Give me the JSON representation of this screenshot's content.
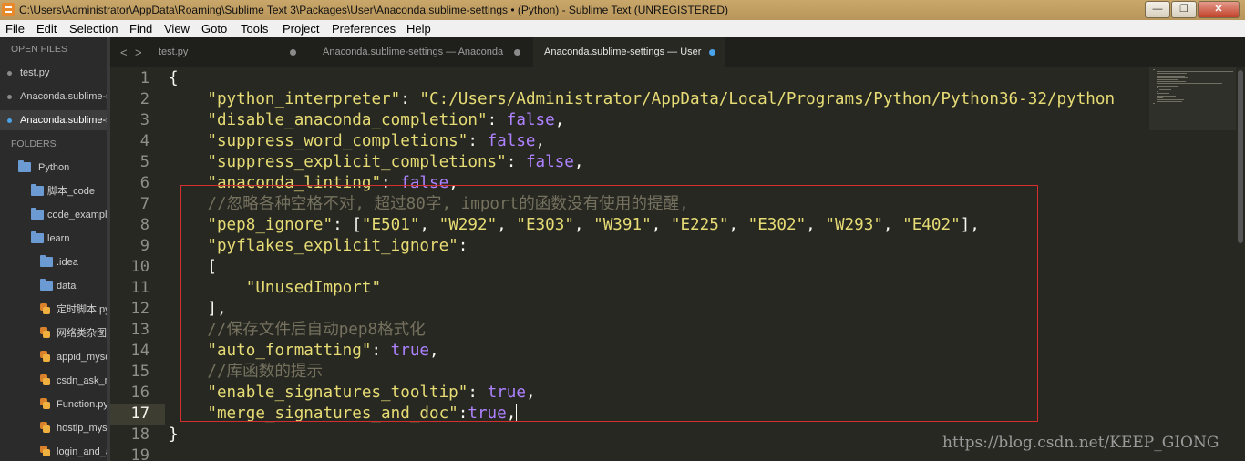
{
  "window": {
    "title": "C:\\Users\\Administrator\\AppData\\Roaming\\Sublime Text 3\\Packages\\User\\Anaconda.sublime-settings • (Python) - Sublime Text (UNREGISTERED)",
    "minimize": "—",
    "maximize": "❐",
    "close": "✕"
  },
  "menu": [
    "File",
    "Edit",
    "Selection",
    "Find",
    "View",
    "Goto",
    "Tools",
    "Project",
    "Preferences",
    "Help"
  ],
  "sidebar": {
    "open_files_header": "OPEN FILES",
    "open_files": [
      {
        "label": "test.py",
        "active": false
      },
      {
        "label": "Anaconda.sublime-s",
        "active": false
      },
      {
        "label": "Anaconda.sublime-s",
        "active": true
      }
    ],
    "folders_header": "FOLDERS",
    "tree": [
      {
        "label": "Python",
        "kind": "folder",
        "depth": 0,
        "open": true
      },
      {
        "label": "脚本_code",
        "kind": "folder",
        "depth": 1
      },
      {
        "label": "code_example",
        "kind": "folder",
        "depth": 1
      },
      {
        "label": "learn",
        "kind": "folder",
        "depth": 1,
        "open": true
      },
      {
        "label": ".idea",
        "kind": "folder",
        "depth": 2
      },
      {
        "label": "data",
        "kind": "folder",
        "depth": 2
      },
      {
        "label": "定时脚本.py",
        "kind": "file",
        "depth": 2
      },
      {
        "label": "网络类杂图",
        "kind": "file",
        "depth": 2
      },
      {
        "label": "appid_mysq",
        "kind": "file",
        "depth": 2
      },
      {
        "label": "csdn_ask_na",
        "kind": "file",
        "depth": 2
      },
      {
        "label": "Function.py",
        "kind": "file",
        "depth": 2
      },
      {
        "label": "hostip_mysq",
        "kind": "file",
        "depth": 2
      },
      {
        "label": "login_and_a",
        "kind": "file",
        "depth": 2
      }
    ]
  },
  "tabs": [
    {
      "label": "test.py",
      "active": false
    },
    {
      "label": "Anaconda.sublime-settings — Anaconda",
      "active": false
    },
    {
      "label": "Anaconda.sublime-settings — User",
      "active": true
    }
  ],
  "nav": {
    "back": "<",
    "forward": ">"
  },
  "editor": {
    "current_line": 17,
    "line_numbers": [
      "1",
      "2",
      "3",
      "4",
      "5",
      "6",
      "7",
      "8",
      "9",
      "10",
      "11",
      "12",
      "13",
      "14",
      "15",
      "16",
      "17",
      "18",
      "19"
    ],
    "lines": [
      [
        {
          "t": "p",
          "v": "{"
        }
      ],
      [
        {
          "t": "p",
          "v": "    "
        },
        {
          "t": "s",
          "v": "\"python_interpreter\""
        },
        {
          "t": "p",
          "v": ": "
        },
        {
          "t": "s",
          "v": "\"C:/Users/Administrator/AppData/Local/Programs/Python/Python36-32/python"
        }
      ],
      [
        {
          "t": "p",
          "v": "    "
        },
        {
          "t": "s",
          "v": "\"disable_anaconda_completion\""
        },
        {
          "t": "p",
          "v": ": "
        },
        {
          "t": "k",
          "v": "false"
        },
        {
          "t": "p",
          "v": ","
        }
      ],
      [
        {
          "t": "p",
          "v": "    "
        },
        {
          "t": "s",
          "v": "\"suppress_word_completions\""
        },
        {
          "t": "p",
          "v": ": "
        },
        {
          "t": "k",
          "v": "false"
        },
        {
          "t": "p",
          "v": ","
        }
      ],
      [
        {
          "t": "p",
          "v": "    "
        },
        {
          "t": "s",
          "v": "\"suppress_explicit_completions\""
        },
        {
          "t": "p",
          "v": ": "
        },
        {
          "t": "k",
          "v": "false"
        },
        {
          "t": "p",
          "v": ","
        }
      ],
      [
        {
          "t": "p",
          "v": "    "
        },
        {
          "t": "s",
          "v": "\"anaconda_linting\""
        },
        {
          "t": "p",
          "v": ": "
        },
        {
          "t": "k",
          "v": "false"
        },
        {
          "t": "p",
          "v": ","
        }
      ],
      [
        {
          "t": "p",
          "v": "    "
        },
        {
          "t": "c",
          "v": "//忽略各种空格不对, 超过80字, import的函数没有使用的提醒,"
        }
      ],
      [
        {
          "t": "p",
          "v": "    "
        },
        {
          "t": "s",
          "v": "\"pep8_ignore\""
        },
        {
          "t": "p",
          "v": ": ["
        },
        {
          "t": "s",
          "v": "\"E501\""
        },
        {
          "t": "p",
          "v": ", "
        },
        {
          "t": "s",
          "v": "\"W292\""
        },
        {
          "t": "p",
          "v": ", "
        },
        {
          "t": "s",
          "v": "\"E303\""
        },
        {
          "t": "p",
          "v": ", "
        },
        {
          "t": "s",
          "v": "\"W391\""
        },
        {
          "t": "p",
          "v": ", "
        },
        {
          "t": "s",
          "v": "\"E225\""
        },
        {
          "t": "p",
          "v": ", "
        },
        {
          "t": "s",
          "v": "\"E302\""
        },
        {
          "t": "p",
          "v": ", "
        },
        {
          "t": "s",
          "v": "\"W293\""
        },
        {
          "t": "p",
          "v": ", "
        },
        {
          "t": "s",
          "v": "\"E402\""
        },
        {
          "t": "p",
          "v": "],"
        }
      ],
      [
        {
          "t": "p",
          "v": "    "
        },
        {
          "t": "s",
          "v": "\"pyflakes_explicit_ignore\""
        },
        {
          "t": "p",
          "v": ":"
        }
      ],
      [
        {
          "t": "p",
          "v": "    ["
        }
      ],
      [
        {
          "t": "p",
          "v": "        "
        },
        {
          "t": "s",
          "v": "\"UnusedImport\""
        }
      ],
      [
        {
          "t": "p",
          "v": "    ],"
        }
      ],
      [
        {
          "t": "p",
          "v": "    "
        },
        {
          "t": "c",
          "v": "//保存文件后自动pep8格式化"
        }
      ],
      [
        {
          "t": "p",
          "v": "    "
        },
        {
          "t": "s",
          "v": "\"auto_formatting\""
        },
        {
          "t": "p",
          "v": ": "
        },
        {
          "t": "k",
          "v": "true"
        },
        {
          "t": "p",
          "v": ","
        }
      ],
      [
        {
          "t": "p",
          "v": "    "
        },
        {
          "t": "c",
          "v": "//库函数的提示"
        }
      ],
      [
        {
          "t": "p",
          "v": "    "
        },
        {
          "t": "s",
          "v": "\"enable_signatures_tooltip\""
        },
        {
          "t": "p",
          "v": ": "
        },
        {
          "t": "k",
          "v": "true"
        },
        {
          "t": "p",
          "v": ","
        }
      ],
      [
        {
          "t": "p",
          "v": "    "
        },
        {
          "t": "s",
          "v": "\"merge_signatures_and_doc\""
        },
        {
          "t": "p",
          "v": ":"
        },
        {
          "t": "k",
          "v": "true"
        },
        {
          "t": "p",
          "v": ","
        },
        {
          "t": "caret",
          "v": ""
        }
      ],
      [
        {
          "t": "p",
          "v": "}"
        }
      ],
      [
        {
          "t": "p",
          "v": ""
        }
      ]
    ]
  },
  "watermark": "https://blog.csdn.net/KEEP_GIONG",
  "colors": {
    "background": "#272822",
    "string": "#e6db74",
    "keyword": "#ae81ff",
    "comment": "#75715e",
    "annotation_box": "#d32f2f",
    "active_dot": "#4aa3e8"
  }
}
